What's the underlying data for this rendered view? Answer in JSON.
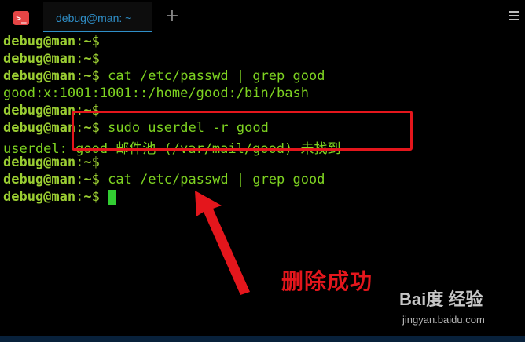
{
  "tab": {
    "label": "debug@man: ~"
  },
  "icons": {
    "app": "terminal-icon",
    "new_tab": "plus-icon",
    "menu": "hamburger-menu-icon"
  },
  "prompt": {
    "user": "debug@man",
    "colon": ":",
    "path": "~",
    "dollar": "$"
  },
  "lines": [
    {
      "type": "prompt",
      "cmd": ""
    },
    {
      "type": "prompt",
      "cmd": ""
    },
    {
      "type": "prompt",
      "cmd": " cat /etc/passwd | grep good"
    },
    {
      "type": "output",
      "text": "good:x:1001:1001::/home/good:/bin/bash"
    },
    {
      "type": "prompt",
      "cmd": ""
    },
    {
      "type": "prompt",
      "cmd": " sudo userdel -r good"
    },
    {
      "type": "output",
      "text": "userdel: good 邮件池 (/var/mail/good) 未找到"
    },
    {
      "type": "prompt",
      "cmd": ""
    },
    {
      "type": "prompt",
      "cmd": " cat /etc/passwd | grep good"
    },
    {
      "type": "prompt-cursor",
      "cmd": " "
    }
  ],
  "annotation": {
    "text": "删除成功"
  },
  "watermark": {
    "logo": "Bai度 经验",
    "url": "jingyan.baidu.com"
  },
  "colors": {
    "prompt": "#9acd32",
    "text": "#7ed321",
    "annotation": "#e4161c",
    "tab_accent": "#2f8fc8"
  }
}
